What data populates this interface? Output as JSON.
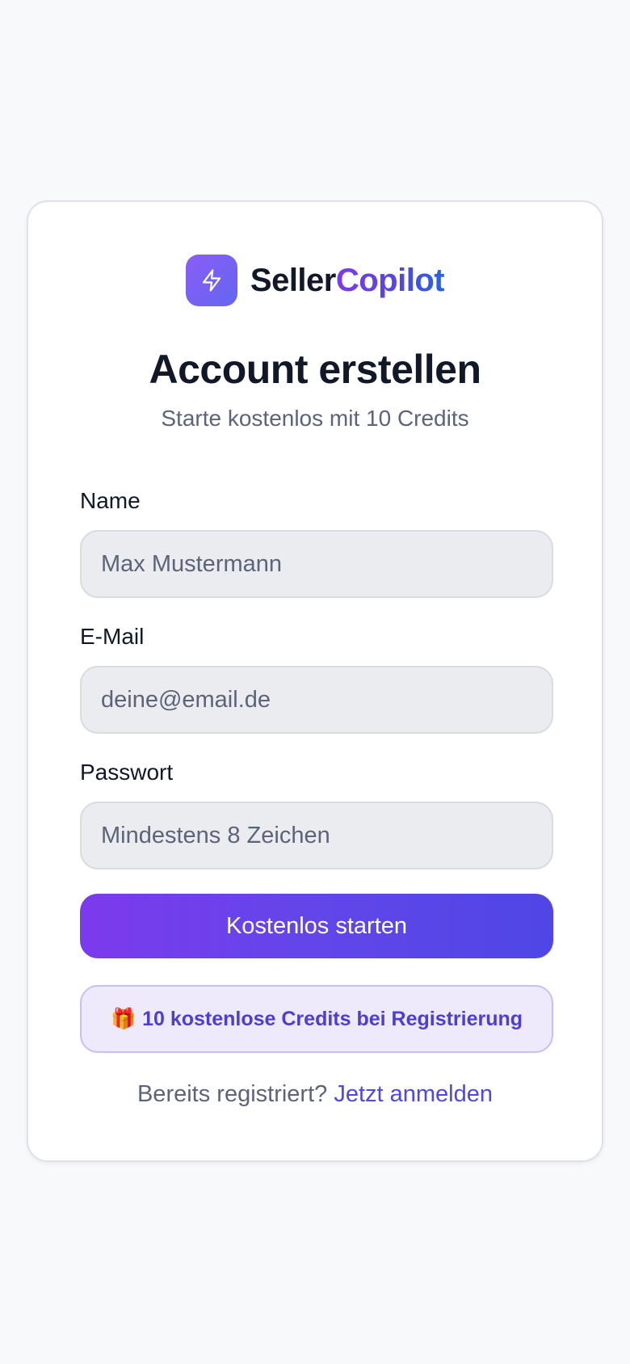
{
  "brand": {
    "name_part1": "Seller",
    "name_part2": "Copilot",
    "icon": "lightning-bolt-icon",
    "accent_start": "#8b5cf6",
    "accent_end": "#4f46e5"
  },
  "header": {
    "title": "Account erstellen",
    "subtitle": "Starte kostenlos mit 10 Credits"
  },
  "form": {
    "name": {
      "label": "Name",
      "placeholder": "Max Mustermann",
      "value": ""
    },
    "email": {
      "label": "E-Mail",
      "placeholder": "deine@email.de",
      "value": ""
    },
    "password": {
      "label": "Passwort",
      "placeholder": "Mindestens 8 Zeichen",
      "value": ""
    },
    "submit_label": "Kostenlos starten"
  },
  "promo": {
    "icon": "gift-icon",
    "text": "10 kostenlose Credits bei Registrierung"
  },
  "footer": {
    "prompt": "Bereits registriert?",
    "link_label": "Jetzt anmelden"
  }
}
